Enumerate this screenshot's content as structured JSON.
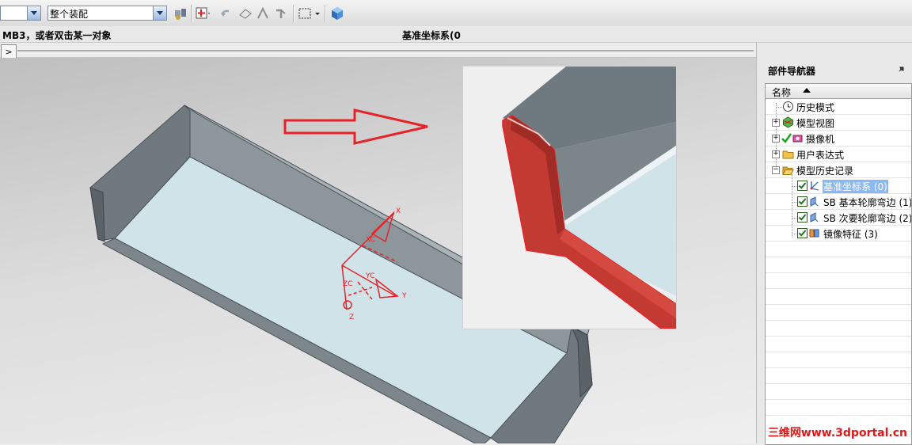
{
  "toolbar": {
    "first_combo_value": "",
    "assembly_combo_value": "整个装配"
  },
  "status": {
    "prompt": "MB3，或者双击某一对象",
    "selection": "基准坐标系(0"
  },
  "viewport": {
    "csys_labels": [
      "X",
      "Y",
      "Z",
      "XC",
      "YC",
      "ZC"
    ]
  },
  "navigator": {
    "title": "部件导航器",
    "column_header": "名称",
    "rows": [
      {
        "label": "历史模式"
      },
      {
        "label": "模型视图"
      },
      {
        "label": "摄像机"
      },
      {
        "label": "用户表达式"
      },
      {
        "label": "模型历史记录"
      },
      {
        "label": "基准坐标系 (0)",
        "selected": true
      },
      {
        "label": "SB 基本轮廓弯边 (1)"
      },
      {
        "label": "SB 次要轮廓弯边 (2)"
      },
      {
        "label": "镜像特征 (3)"
      }
    ]
  },
  "watermark": "三维网www.3dportal.cn",
  "colors": {
    "highlight": "#8ab9f2",
    "part_face": "#cfe3e8",
    "part_wall": "#7d868b",
    "annotation_red": "#e8222a"
  }
}
